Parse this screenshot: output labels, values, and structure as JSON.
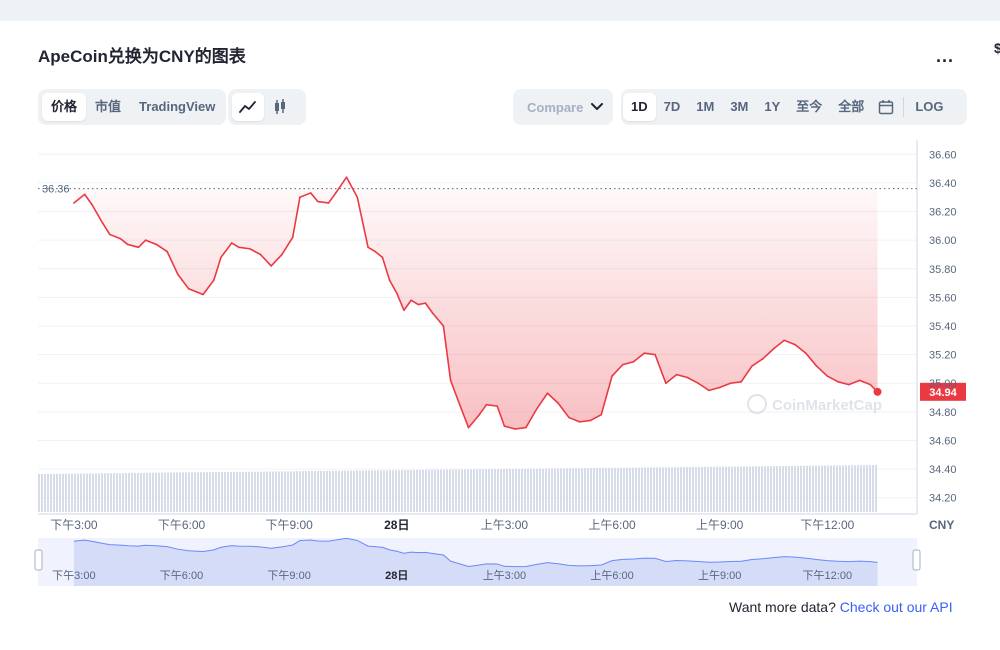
{
  "page": {
    "title": "ApeCoin兑换为CNY的图表",
    "more_label": "...",
    "edge_glyph": "$"
  },
  "toolbar": {
    "types": [
      {
        "label": "价格",
        "active": true
      },
      {
        "label": "市值",
        "active": false
      },
      {
        "label": "TradingView",
        "active": false
      }
    ],
    "styles": [
      {
        "icon": "line-chart-icon",
        "active": true
      },
      {
        "icon": "candlestick-icon",
        "active": false
      }
    ],
    "compare_label": "Compare",
    "ranges": [
      {
        "label": "1D",
        "active": true
      },
      {
        "label": "7D",
        "active": false
      },
      {
        "label": "1M",
        "active": false
      },
      {
        "label": "3M",
        "active": false
      },
      {
        "label": "1Y",
        "active": false
      },
      {
        "label": "至今",
        "active": false
      },
      {
        "label": "全部",
        "active": false
      }
    ],
    "calendar_icon": "calendar-icon",
    "log_label": "LOG"
  },
  "footer": {
    "prefix": "Want more data?",
    "link": "Check out our API"
  },
  "chart_data": {
    "type": "area",
    "currency": "CNY",
    "open_reference_price": 36.36,
    "current_price": 34.94,
    "ylim": [
      34.1,
      36.7
    ],
    "yticks": [
      36.6,
      36.4,
      36.2,
      36.0,
      35.8,
      35.6,
      35.4,
      35.2,
      35.0,
      34.8,
      34.6,
      34.4,
      34.2
    ],
    "ytick_labels": [
      "36.60",
      "36.40",
      "36.20",
      "36.00",
      "35.80",
      "35.60",
      "35.40",
      "35.20",
      "35.00",
      "34.80",
      "34.60",
      "34.40",
      "34.20"
    ],
    "x_range": [
      14,
      38.5
    ],
    "x_ticks": [
      {
        "x": 15,
        "label": "下午3:00",
        "bold": false
      },
      {
        "x": 18,
        "label": "下午6:00",
        "bold": false
      },
      {
        "x": 21,
        "label": "下午9:00",
        "bold": false
      },
      {
        "x": 24,
        "label": "28日",
        "bold": true
      },
      {
        "x": 27,
        "label": "上午3:00",
        "bold": false
      },
      {
        "x": 30,
        "label": "上午6:00",
        "bold": false
      },
      {
        "x": 33,
        "label": "上午9:00",
        "bold": false
      },
      {
        "x": 36,
        "label": "下午12:00",
        "bold": false
      }
    ],
    "series": [
      {
        "name": "价格",
        "color_up": "#16c784",
        "color_down": "#ea3943",
        "x": [
          15.0,
          15.3,
          15.5,
          15.8,
          16.0,
          16.3,
          16.5,
          16.8,
          17.0,
          17.3,
          17.6,
          17.9,
          18.2,
          18.6,
          18.9,
          19.1,
          19.4,
          19.6,
          19.9,
          20.2,
          20.5,
          20.8,
          21.1,
          21.3,
          21.6,
          21.8,
          22.1,
          22.3,
          22.6,
          22.9,
          23.2,
          23.4,
          23.6,
          23.8,
          24.0,
          24.2,
          24.4,
          24.6,
          24.8,
          25.0,
          25.3,
          25.5,
          25.8,
          26.0,
          26.3,
          26.5,
          26.8,
          27.0,
          27.3,
          27.6,
          27.9,
          28.2,
          28.5,
          28.8,
          29.1,
          29.4,
          29.7,
          30.0,
          30.3,
          30.6,
          30.9,
          31.2,
          31.5,
          31.8,
          32.1,
          32.4,
          32.7,
          33.0,
          33.3,
          33.6,
          33.9,
          34.2,
          34.5,
          34.8,
          35.1,
          35.4,
          35.7,
          36.0,
          36.3,
          36.6,
          36.9,
          37.2,
          37.4
        ],
        "values": [
          36.26,
          36.32,
          36.25,
          36.12,
          36.04,
          36.01,
          35.97,
          35.95,
          36.0,
          35.97,
          35.92,
          35.76,
          35.66,
          35.62,
          35.72,
          35.88,
          35.98,
          35.95,
          35.94,
          35.9,
          35.82,
          35.9,
          36.02,
          36.3,
          36.33,
          36.27,
          36.26,
          36.33,
          36.44,
          36.3,
          35.95,
          35.92,
          35.88,
          35.72,
          35.63,
          35.51,
          35.58,
          35.55,
          35.56,
          35.49,
          35.4,
          35.02,
          34.82,
          34.69,
          34.78,
          34.85,
          34.84,
          34.7,
          34.68,
          34.69,
          34.82,
          34.93,
          34.86,
          34.76,
          34.73,
          34.74,
          34.78,
          35.05,
          35.13,
          35.15,
          35.21,
          35.2,
          35.0,
          35.06,
          35.04,
          35.0,
          34.95,
          34.97,
          35.0,
          35.01,
          35.12,
          35.17,
          35.24,
          35.3,
          35.27,
          35.21,
          35.12,
          35.05,
          35.01,
          34.99,
          35.02,
          34.99,
          34.94
        ]
      }
    ],
    "volume_note": "",
    "navigator": {
      "x_ticks": [
        {
          "x": 15,
          "label": "下午3:00",
          "bold": false
        },
        {
          "x": 18,
          "label": "下午6:00",
          "bold": false
        },
        {
          "x": 21,
          "label": "下午9:00",
          "bold": false
        },
        {
          "x": 24,
          "label": "28日",
          "bold": true
        },
        {
          "x": 27,
          "label": "上午3:00",
          "bold": false
        },
        {
          "x": 30,
          "label": "上午6:00",
          "bold": false
        },
        {
          "x": 33,
          "label": "上午9:00",
          "bold": false
        },
        {
          "x": 36,
          "label": "下午12:00",
          "bold": false
        }
      ]
    },
    "watermark": "CoinMarketCap"
  }
}
